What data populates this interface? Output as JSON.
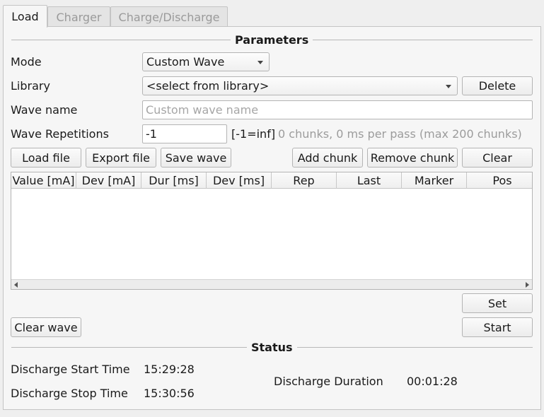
{
  "tabs": [
    {
      "label": "Load",
      "active": true
    },
    {
      "label": "Charger",
      "active": false
    },
    {
      "label": "Charge/Discharge",
      "active": false
    }
  ],
  "parameters": {
    "title": "Parameters",
    "mode_label": "Mode",
    "mode_value": "Custom Wave",
    "library_label": "Library",
    "library_value": "<select from library>",
    "delete_label": "Delete",
    "wave_name_label": "Wave name",
    "wave_name_placeholder": "Custom wave name",
    "wave_name_value": "",
    "repetitions_label": "Wave Repetitions",
    "repetitions_value": "-1",
    "repetitions_hint": "[-1=inf]",
    "chunks_info": "0 chunks, 0 ms per pass (max 200 chunks)"
  },
  "toolbar": {
    "load_file": "Load file",
    "export_file": "Export file",
    "save_wave": "Save wave",
    "add_chunk": "Add chunk",
    "remove_chunk": "Remove chunk",
    "clear": "Clear"
  },
  "table": {
    "columns": [
      "Value [mA]",
      "Dev [mA]",
      "Dur [ms]",
      "Dev [ms]",
      "Rep",
      "Last",
      "Marker",
      "Pos"
    ],
    "rows": []
  },
  "actions": {
    "set": "Set",
    "clear_wave": "Clear wave",
    "start": "Start"
  },
  "status": {
    "title": "Status",
    "start_time_label": "Discharge Start Time",
    "start_time_value": "15:29:28",
    "stop_time_label": "Discharge Stop Time",
    "stop_time_value": "15:30:56",
    "duration_label": "Discharge Duration",
    "duration_value": "00:01:28"
  },
  "icons": {
    "combo_arrow": "chevron-down-icon",
    "scroll_left": "arrow-left-icon",
    "scroll_right": "arrow-right-icon"
  }
}
